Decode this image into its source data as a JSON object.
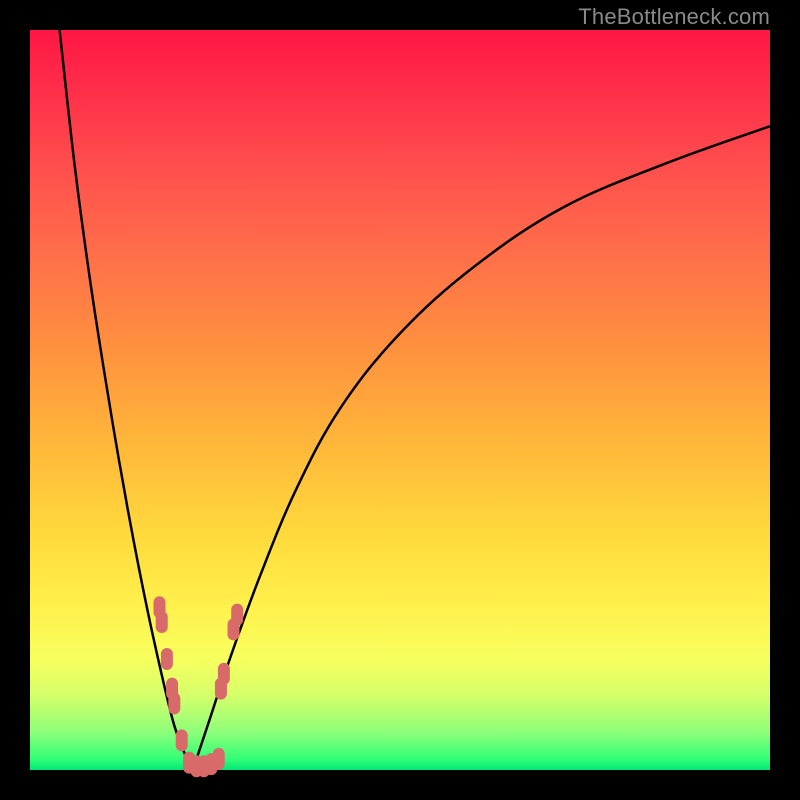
{
  "watermark": "TheBottleneck.com",
  "colors": {
    "background": "#000000",
    "curve": "#000000",
    "marker": "#d86a6a",
    "gradient_top": "#ff1744",
    "gradient_bottom": "#00e676"
  },
  "chart_data": {
    "type": "line",
    "title": "",
    "xlabel": "",
    "ylabel": "",
    "xlim": [
      0,
      100
    ],
    "ylim": [
      0,
      100
    ],
    "series": [
      {
        "name": "left-branch",
        "x": [
          4,
          6,
          8,
          10,
          12,
          14,
          16,
          18,
          19.5,
          21,
          22
        ],
        "y": [
          100,
          82,
          67,
          54,
          42,
          31,
          21,
          12,
          6,
          2,
          0
        ]
      },
      {
        "name": "right-branch",
        "x": [
          22,
          24,
          27,
          31,
          36,
          42,
          50,
          60,
          72,
          86,
          100
        ],
        "y": [
          0,
          6,
          15,
          26,
          38,
          49,
          59,
          68,
          76,
          82,
          87
        ]
      }
    ],
    "markers": {
      "name": "highlighted-points",
      "color": "#d86a6a",
      "points": [
        {
          "x": 17.5,
          "y": 22
        },
        {
          "x": 17.8,
          "y": 20
        },
        {
          "x": 18.5,
          "y": 15
        },
        {
          "x": 19.2,
          "y": 11
        },
        {
          "x": 19.5,
          "y": 9
        },
        {
          "x": 20.5,
          "y": 4
        },
        {
          "x": 21.5,
          "y": 1
        },
        {
          "x": 22.5,
          "y": 0.5
        },
        {
          "x": 23.5,
          "y": 0.5
        },
        {
          "x": 24.5,
          "y": 0.8
        },
        {
          "x": 25.5,
          "y": 1.5
        },
        {
          "x": 25.8,
          "y": 11
        },
        {
          "x": 26.2,
          "y": 13
        },
        {
          "x": 27.5,
          "y": 19
        },
        {
          "x": 28.0,
          "y": 21
        }
      ]
    },
    "notch_x": 22
  }
}
